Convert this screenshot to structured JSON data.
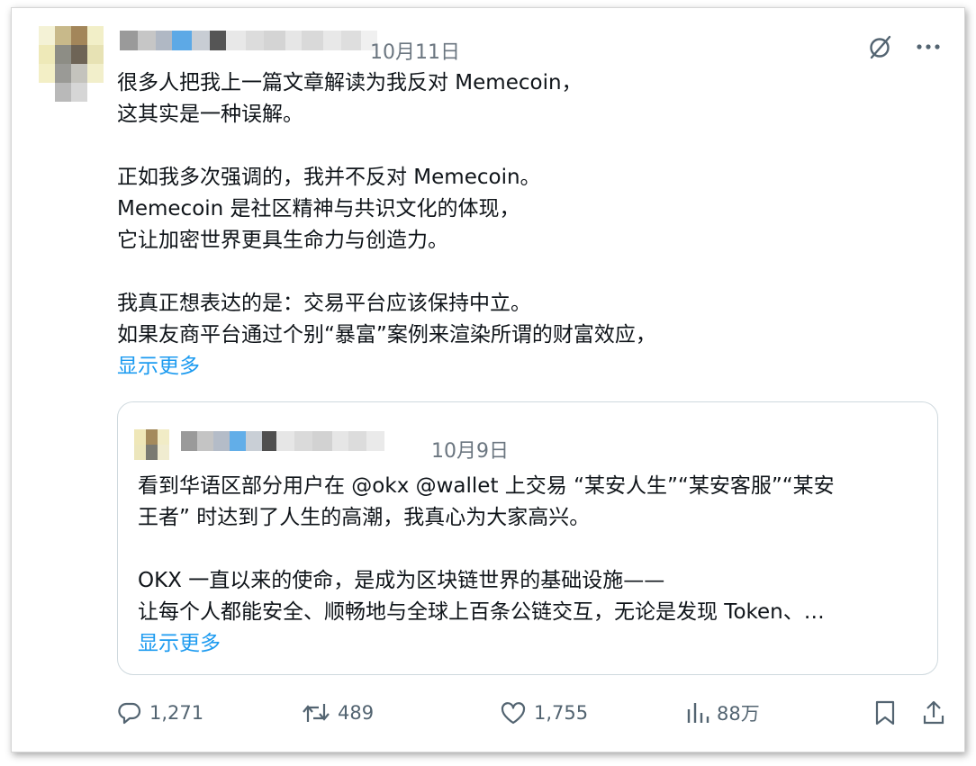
{
  "tweet": {
    "date": "10月11日",
    "paragraphs": [
      "很多人把我上一篇文章解读为我反对 Memecoin，\n这其实是一种误解。",
      "正如我多次强调的，我并不反对 Memecoin。\nMemecoin 是社区精神与共识文化的体现，\n它让加密世界更具生命力与创造力。",
      "我真正想表达的是：交易平台应该保持中立。\n如果友商平台通过个别“暴富”案例来渲染所谓的财富效应，"
    ],
    "show_more": "显示更多"
  },
  "quoted_tweet": {
    "date": "10月9日",
    "paragraphs": [
      "看到华语区部分用户在 @okx @wallet 上交易 “某安人生”“某安客服”“某安\n王者” 时达到了人生的高潮，我真心为大家高兴。",
      "OKX 一直以来的使命，是成为区块链世界的基础设施——\n让每个人都能安全、顺畅地与全球上百条公链交互，无论是发现 Token、…"
    ],
    "show_more": "显示更多"
  },
  "actions": {
    "replies": "1,271",
    "reposts": "489",
    "likes": "1,755",
    "views": "88万"
  },
  "icons": {
    "grok": "grok-icon",
    "more": "more-dots-icon",
    "reply": "reply-icon",
    "repost": "repost-icon",
    "like": "heart-icon",
    "views": "views-chart-icon",
    "bookmark": "bookmark-icon",
    "share": "share-icon"
  },
  "colors": {
    "link": "#1d9bf0",
    "muted": "#536471",
    "text": "#0f1419",
    "border": "#cfd9de"
  }
}
